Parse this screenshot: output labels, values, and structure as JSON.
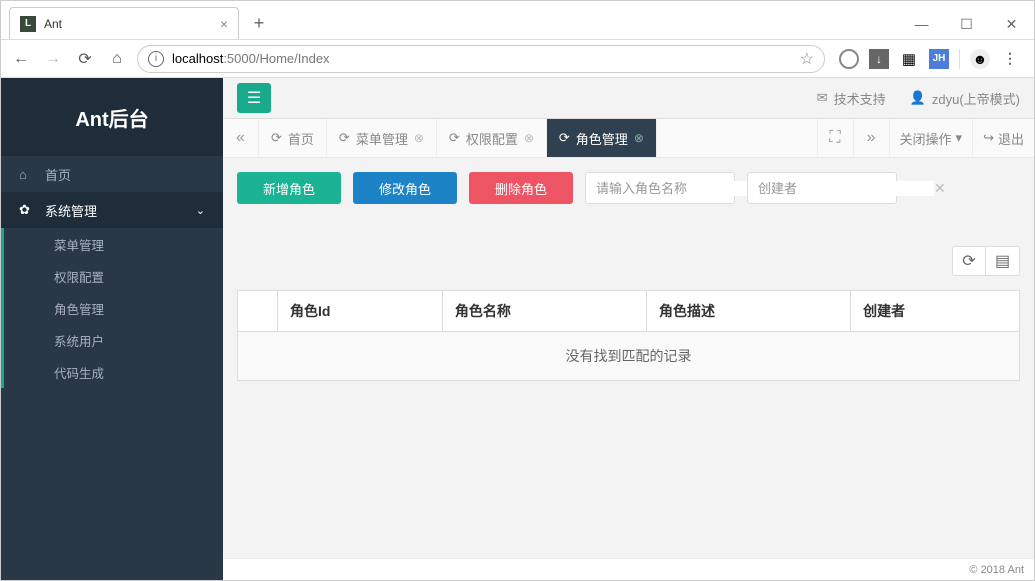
{
  "browser": {
    "tab_title": "Ant",
    "favicon_letter": "L",
    "url_host": "localhost",
    "url_port_path": ":5000/Home/Index"
  },
  "sidebar": {
    "brand": "Ant后台",
    "items": [
      {
        "label": "首页",
        "icon": "home"
      },
      {
        "label": "系统管理",
        "icon": "gear",
        "expanded": true
      }
    ],
    "sub_items": [
      "菜单管理",
      "权限配置",
      "角色管理",
      "系统用户",
      "代码生成"
    ]
  },
  "topbar": {
    "support": "技术支持",
    "user": "zdyu(上帝模式)"
  },
  "page_tabs": {
    "items": [
      {
        "label": "首页",
        "closable": false
      },
      {
        "label": "菜单管理",
        "closable": true
      },
      {
        "label": "权限配置",
        "closable": true
      },
      {
        "label": "角色管理",
        "closable": true,
        "active": true
      }
    ],
    "close_menu": "关闭操作",
    "logout": "退出"
  },
  "toolbar": {
    "add": "新增角色",
    "edit": "修改角色",
    "delete": "删除角色",
    "filter1_placeholder": "请输入角色名称",
    "filter2_placeholder": "创建者"
  },
  "table": {
    "columns": [
      "角色Id",
      "角色名称",
      "角色描述",
      "创建者"
    ],
    "empty_text": "没有找到匹配的记录"
  },
  "footer": "© 2018 Ant"
}
